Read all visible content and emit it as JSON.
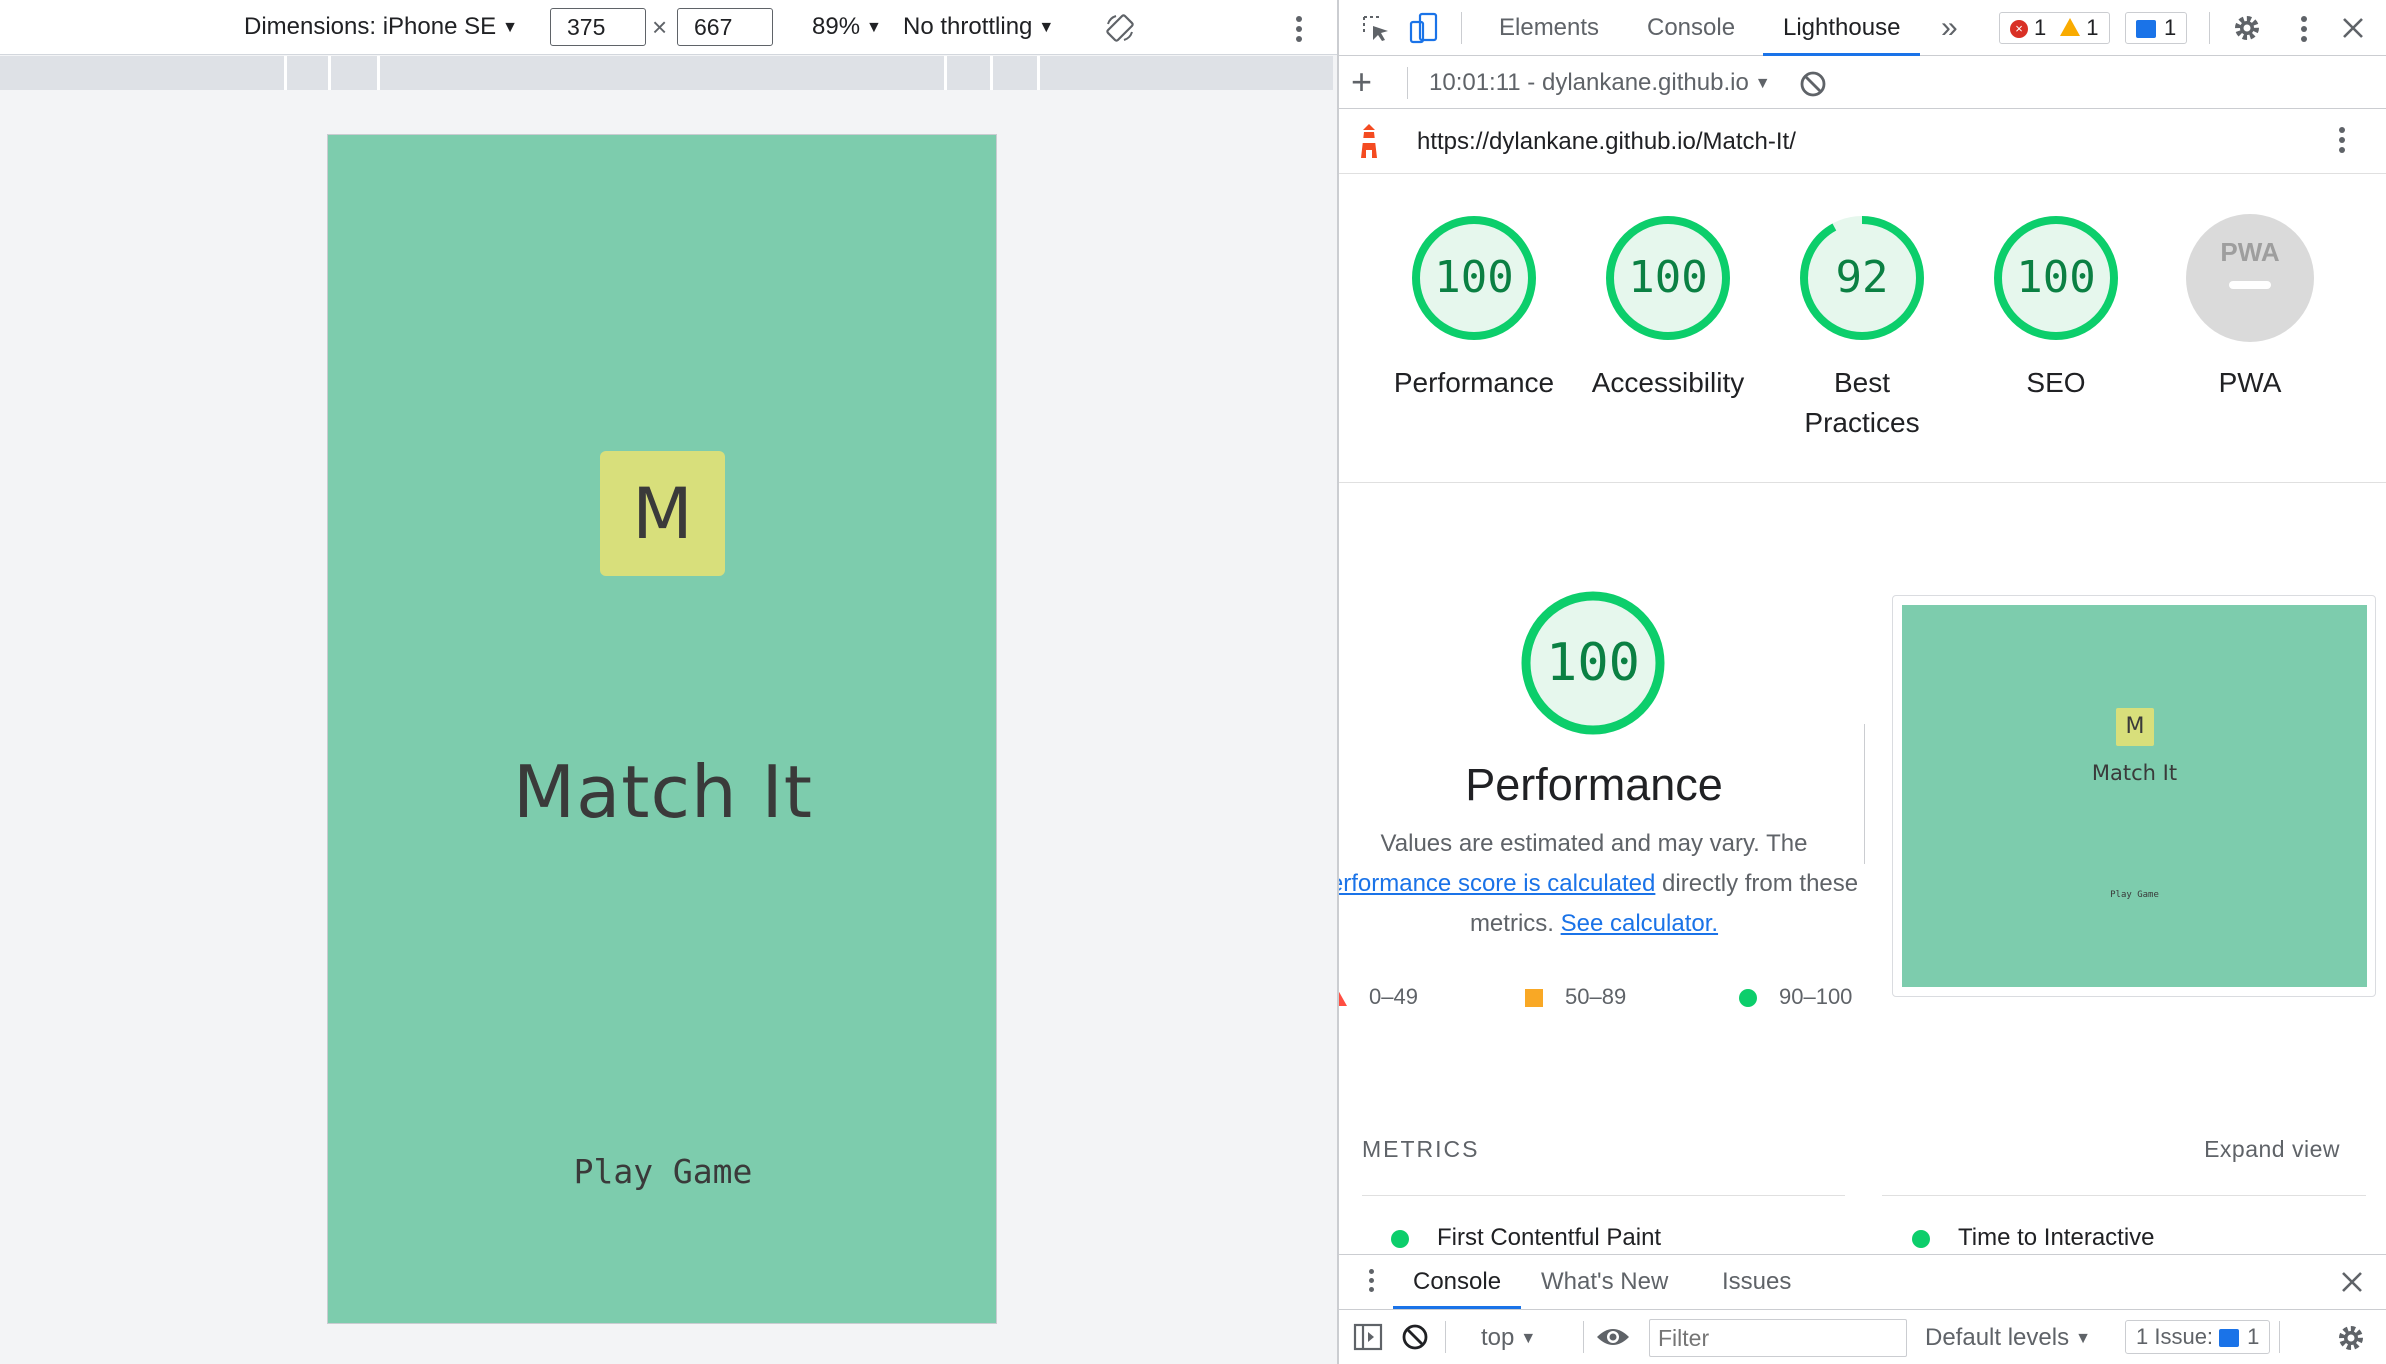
{
  "device_toolbar": {
    "dimensions_label": "Dimensions: iPhone SE",
    "width_value": "375",
    "times": "×",
    "height_value": "667",
    "zoom": "89%",
    "throttling": "No throttling"
  },
  "app": {
    "logo_letter": "M",
    "title": "Match It",
    "play_button": "Play Game",
    "bg_color": "#7dccad",
    "logo_color": "#d8df7b"
  },
  "devtools": {
    "tabs": [
      "Elements",
      "Console",
      "Lighthouse"
    ],
    "active_tab": "Lighthouse",
    "more_tabs": "»",
    "errors_count": "1",
    "warnings_count": "1",
    "messages_count": "1"
  },
  "lighthouse": {
    "add_label": "+",
    "report_selector": "10:01:11 - dylankane.github.io",
    "url": "https://dylankane.github.io/Match-It/",
    "scores": [
      {
        "label": "Performance",
        "value": "100",
        "score": 100
      },
      {
        "label": "Accessibility",
        "value": "100",
        "score": 100
      },
      {
        "label": "Best",
        "label2": "Practices",
        "value": "92",
        "score": 92
      },
      {
        "label": "SEO",
        "value": "100",
        "score": 100
      },
      {
        "label": "PWA",
        "badge": "PWA"
      }
    ],
    "performance": {
      "score": "100",
      "title": "Performance",
      "desc_1": "Values are estimated and may vary. The",
      "desc_link_1": "erformance score is calculated",
      "desc_2": " directly from these",
      "desc_3": "metrics. ",
      "desc_link_2": "See calculator.",
      "legend": [
        "0–49",
        "50–89",
        "90–100"
      ]
    },
    "metrics_heading": "METRICS",
    "expand_view": "Expand view",
    "metrics": [
      "First Contentful Paint",
      "Time to Interactive"
    ]
  },
  "drawer": {
    "tabs": [
      "Console",
      "What's New",
      "Issues"
    ],
    "active_tab": "Console",
    "context": "top",
    "filter_placeholder": "Filter",
    "levels": "Default levels",
    "issues_label": "1 Issue:",
    "issues_count": "1"
  },
  "colors": {
    "accent": "#1a73e8",
    "pass_green": "#0cce6b",
    "score_text": "#0b8043",
    "average_orange": "#f9a825",
    "fail_red": "#ff4e42"
  }
}
